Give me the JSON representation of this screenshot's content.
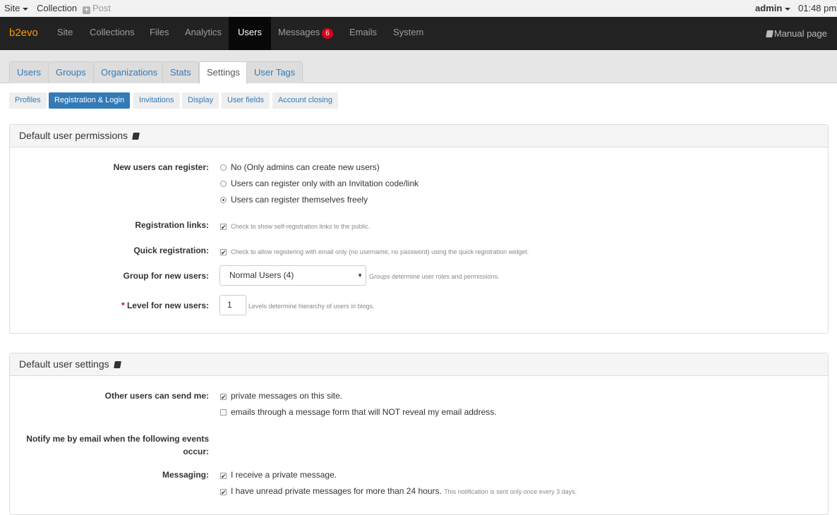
{
  "topbar": {
    "site": "Site",
    "collection": "Collection",
    "post": "Post",
    "user": "admin",
    "time": "01:48 pm"
  },
  "nav": {
    "brand": "b2evo",
    "items": [
      "Site",
      "Collections",
      "Files",
      "Analytics",
      "Users",
      "Messages",
      "Emails",
      "System"
    ],
    "active": "Users",
    "messages_badge": "6",
    "manual": "Manual page"
  },
  "tabs": {
    "items": [
      "Users",
      "Groups",
      "Organizations",
      "Stats",
      "Settings",
      "User Tags"
    ],
    "active": "Settings"
  },
  "subtabs": {
    "items": [
      "Profiles",
      "Registration & Login",
      "Invitations",
      "Display",
      "User fields",
      "Account closing"
    ],
    "active": "Registration & Login"
  },
  "panel1": {
    "title": "Default user permissions",
    "register_label": "New users can register:",
    "register_options": [
      {
        "label": "No (Only admins can create new users)",
        "checked": false
      },
      {
        "label": "Users can register only with an Invitation code/link",
        "checked": false
      },
      {
        "label": "Users can register themselves freely",
        "checked": true
      }
    ],
    "reg_links_label": "Registration links:",
    "reg_links_note": "Check to show self-registration links to the public.",
    "quick_label": "Quick registration:",
    "quick_note": "Check to allow registering with email only (no username, no password) using the quick registration widget.",
    "group_label": "Group for new users:",
    "group_value": "Normal Users (4)",
    "group_note": "Groups determine user roles and permissions.",
    "level_req": "*",
    "level_label": "Level for new users:",
    "level_value": "1",
    "level_note": "Levels determine hierarchy of users in blogs."
  },
  "panel2": {
    "title": "Default user settings",
    "send_label": "Other users can send me:",
    "send_opt1": "private messages on this site.",
    "send_opt2": "emails through a message form that will NOT reveal my email address.",
    "notify_label_1": "Notify me by email when the following events",
    "notify_label_2": "occur:",
    "msg_label": "Messaging:",
    "msg_opt1": "I receive a private message.",
    "msg_opt2": "I have unread private messages for more than 24 hours.",
    "msg_opt2_note": "This notification is sent only once every 3 days."
  }
}
